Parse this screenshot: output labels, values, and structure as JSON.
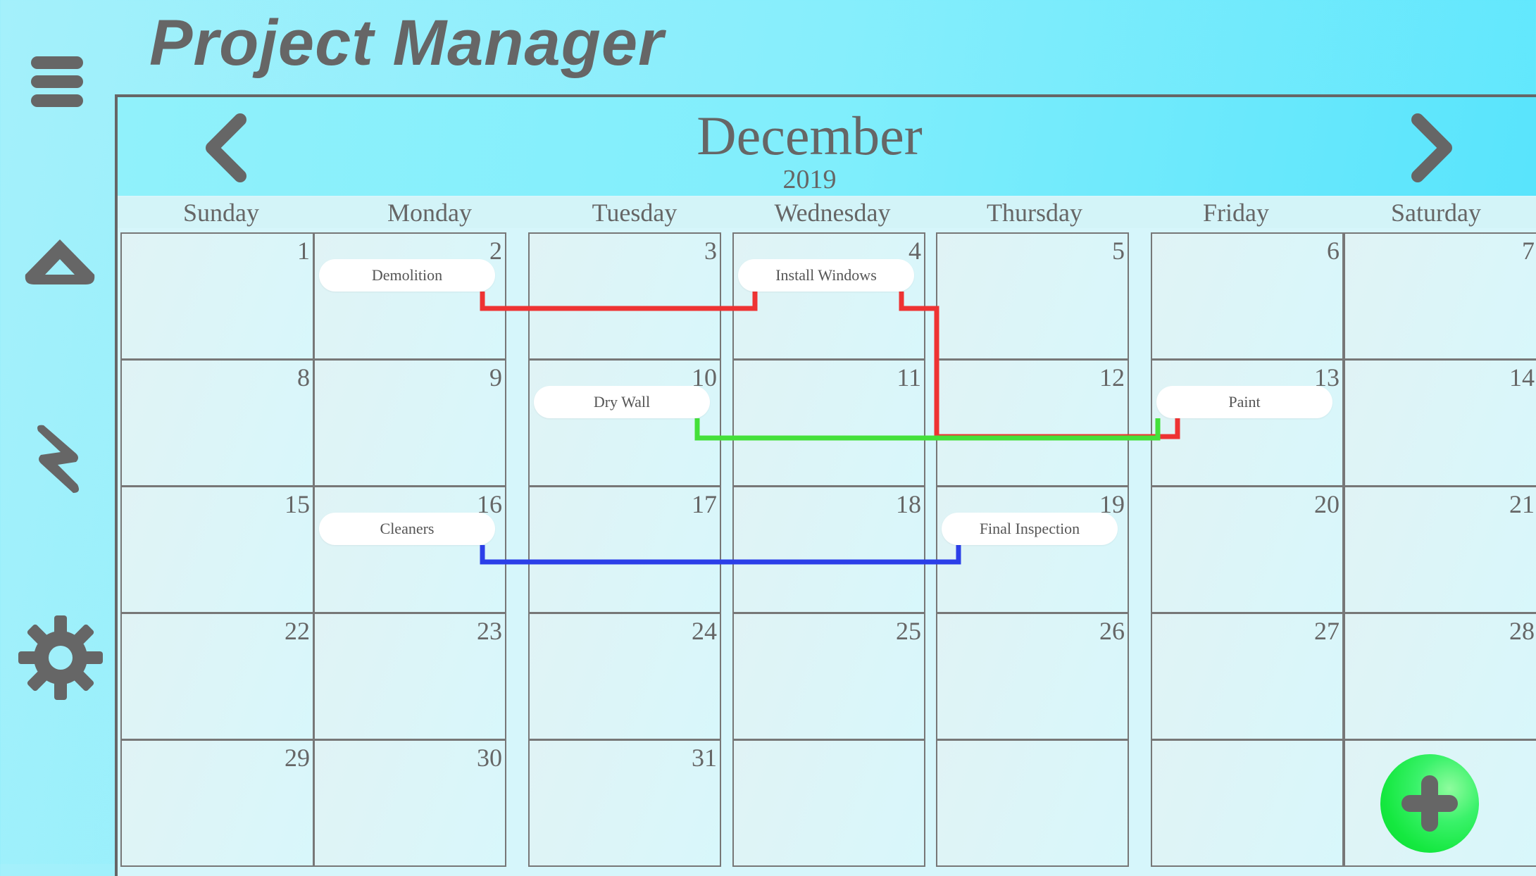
{
  "app": {
    "title": "Project Manager"
  },
  "sidebar": {
    "items": [
      {
        "icon": "menu-icon"
      },
      {
        "icon": "caret-up-icon"
      },
      {
        "icon": "lightning-icon"
      },
      {
        "icon": "gear-icon"
      }
    ]
  },
  "calendar": {
    "month": "December",
    "year": "2019",
    "prev_icon": "chevron-left-icon",
    "next_icon": "chevron-right-icon",
    "weekdays": [
      "Sunday",
      "Monday",
      "Tuesday",
      "Wednesday",
      "Thursday",
      "Friday",
      "Saturday"
    ],
    "weeks": [
      [
        "1",
        "2",
        "3",
        "4",
        "5",
        "6",
        "7"
      ],
      [
        "8",
        "9",
        "10",
        "11",
        "12",
        "13",
        "14"
      ],
      [
        "15",
        "16",
        "17",
        "18",
        "19",
        "20",
        "21"
      ],
      [
        "22",
        "23",
        "24",
        "25",
        "26",
        "27",
        "28"
      ],
      [
        "29",
        "30",
        "31",
        "",
        "",
        "",
        ""
      ]
    ],
    "tasks": [
      {
        "label": "Demolition",
        "day": "2"
      },
      {
        "label": "Install Windows",
        "day": "4"
      },
      {
        "label": "Dry Wall",
        "day": "10"
      },
      {
        "label": "Paint",
        "day": "13"
      },
      {
        "label": "Cleaners",
        "day": "16"
      },
      {
        "label": "Final Inspection",
        "day": "19"
      }
    ],
    "dependencies": [
      {
        "from": "Demolition",
        "to": "Install Windows",
        "color": "#ee3333"
      },
      {
        "from": "Install Windows",
        "to": "Paint",
        "color": "#ee3333"
      },
      {
        "from": "Dry Wall",
        "to": "Paint",
        "color": "#44e03a"
      },
      {
        "from": "Cleaners",
        "to": "Final Inspection",
        "color": "#2b3fe8"
      }
    ]
  },
  "fab": {
    "icon": "plus-icon",
    "color": "#14e83f"
  }
}
